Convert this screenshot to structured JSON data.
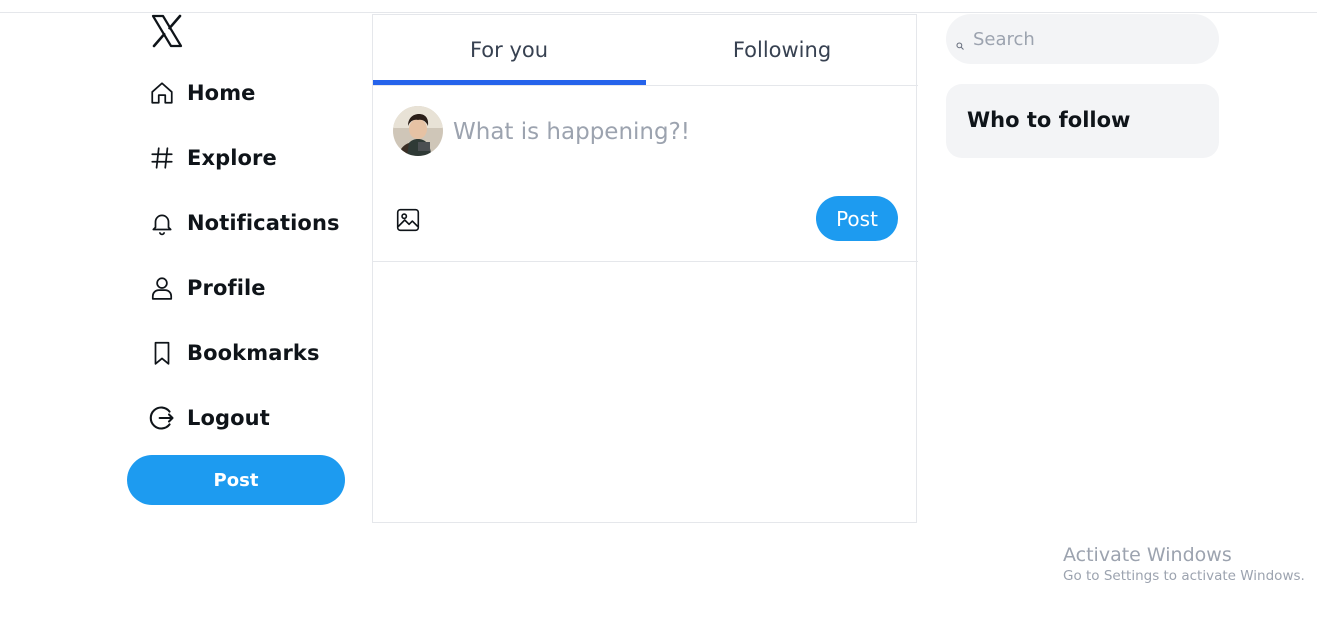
{
  "sidebar": {
    "logo_icon": "x-logo-icon",
    "items": [
      {
        "label": "Home",
        "icon": "home-icon"
      },
      {
        "label": "Explore",
        "icon": "hashtag-icon"
      },
      {
        "label": "Notifications",
        "icon": "bell-icon"
      },
      {
        "label": "Profile",
        "icon": "user-icon"
      },
      {
        "label": "Bookmarks",
        "icon": "bookmark-icon"
      },
      {
        "label": "Logout",
        "icon": "logout-icon"
      }
    ],
    "post_label": "Post"
  },
  "main": {
    "tabs": [
      {
        "label": "For you",
        "active": true
      },
      {
        "label": "Following",
        "active": false
      }
    ],
    "composer": {
      "placeholder": "What is happening?!",
      "value": "",
      "media_icon": "image-icon",
      "post_label": "Post"
    }
  },
  "right": {
    "search": {
      "placeholder": "Search",
      "value": "",
      "icon": "search-icon"
    },
    "who_to_follow_title": "Who to follow"
  },
  "watermark": {
    "title": "Activate Windows",
    "subtitle": "Go to Settings to activate Windows."
  },
  "colors": {
    "accent": "#1d9bf0",
    "tab_indicator": "#2563eb",
    "panel_bg": "#f3f4f6",
    "border": "#e5e7eb"
  }
}
